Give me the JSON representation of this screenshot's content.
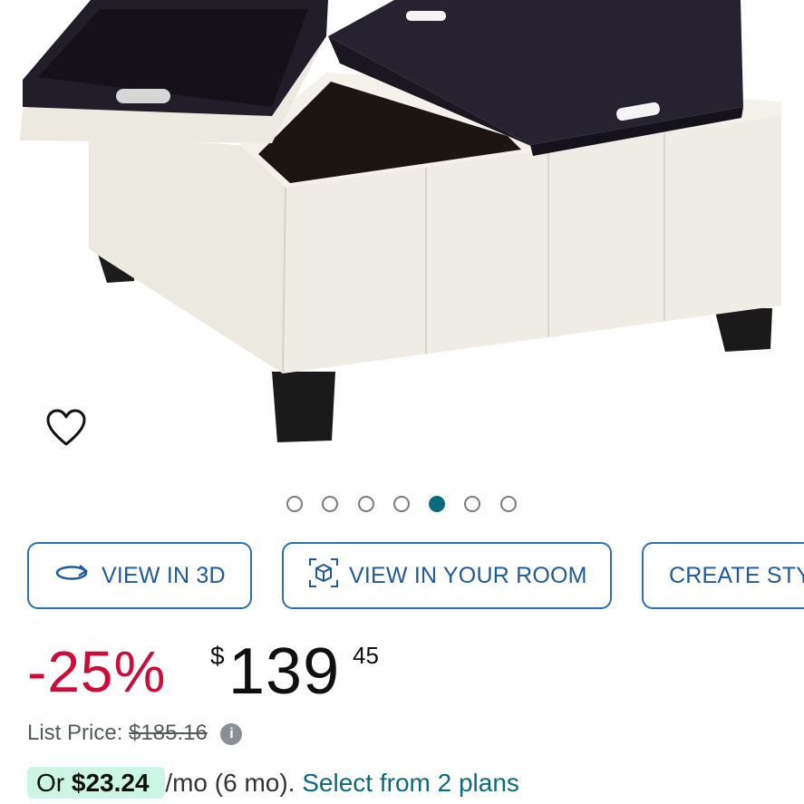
{
  "gallery": {
    "image_alt": "cream leather storage ottoman with two black serving trays",
    "wishlist_icon": "heart-outline-icon",
    "dots_total": 7,
    "active_index": 4
  },
  "actions": [
    {
      "label": "VIEW IN 3D",
      "icon": "rotate-3d-icon"
    },
    {
      "label": "VIEW IN YOUR ROOM",
      "icon": "ar-cube-icon"
    },
    {
      "label": "CREATE STY",
      "icon": ""
    }
  ],
  "pricing": {
    "discount": "-25%",
    "currency_symbol": "$",
    "whole": "139",
    "fraction": "45",
    "list_label": "List Price:",
    "list_price": "$185.16",
    "info_icon": "info-icon",
    "installment_prefix": "Or",
    "installment_amount": "$23.24",
    "installment_terms": "/mo (6 mo).",
    "installment_link": "Select from 2 plans"
  },
  "colors": {
    "discount": "#cc0c39",
    "accent": "#0a6b7f",
    "chip_border": "#2b70b3",
    "installment_bg": "#cbf5e4"
  }
}
